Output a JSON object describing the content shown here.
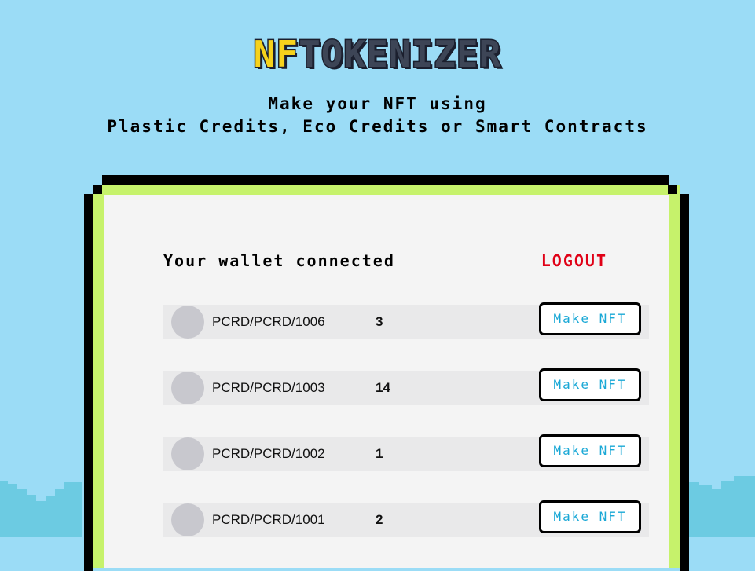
{
  "logo": {
    "highlight": "NF",
    "rest": "TOKENIZER"
  },
  "tagline": {
    "line1": "Make your NFT using",
    "line2": "Plastic Credits, Eco Credits or Smart Contracts"
  },
  "wallet": {
    "title": "Your wallet connected",
    "logout_label": "LOGOUT"
  },
  "tokens": [
    {
      "name": "PCRD/PCRD/1006",
      "qty": "3",
      "button": "Make NFT"
    },
    {
      "name": "PCRD/PCRD/1003",
      "qty": "14",
      "button": "Make NFT"
    },
    {
      "name": "PCRD/PCRD/1002",
      "qty": "1",
      "button": "Make NFT"
    },
    {
      "name": "PCRD/PCRD/1001",
      "qty": "2",
      "button": "Make NFT"
    }
  ],
  "colors": {
    "sky": "#9bdcf6",
    "hills": "#6ccbe2",
    "frame_green": "#c6f26b",
    "logo_yellow": "#f6d21c",
    "logout_red": "#e00016",
    "button_text": "#1aa8d6"
  }
}
